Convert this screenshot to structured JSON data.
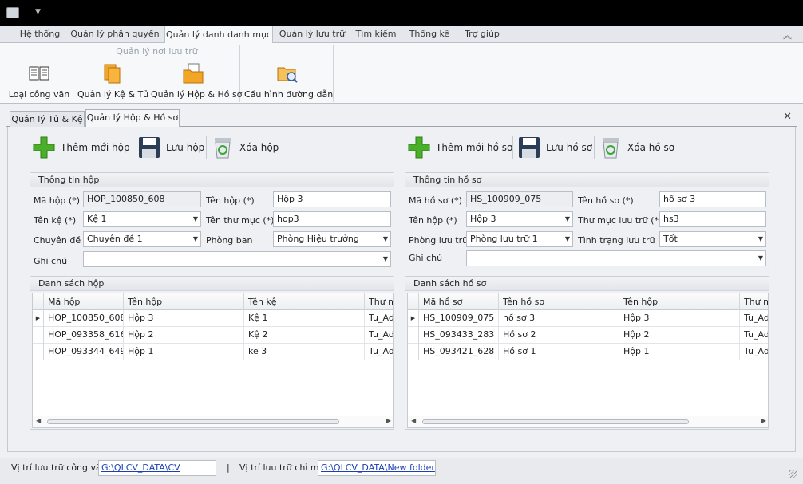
{
  "ribbon": {
    "tabs": [
      "Hệ thống",
      "Quản lý phân quyền",
      "Quản lý danh danh mục",
      "Quản lý lưu trữ",
      "Tìm kiếm",
      "Thống kê",
      "Trợ giúp"
    ],
    "group_title": "Quản lý nơi lưu trữ",
    "buttons": [
      "Loại công văn",
      "Quản lý Kệ & Tủ",
      "Quản lý Hộp & Hồ sơ",
      "Cấu hình đường dẫn"
    ]
  },
  "doc_tabs": [
    "Quản lý Tủ & Kệ",
    "Quản lý Hộp & Hồ sơ"
  ],
  "toolbar_left": {
    "add": "Thêm mới hộp",
    "save": "Lưu hộp",
    "delete": "Xóa hộp"
  },
  "toolbar_right": {
    "add": "Thêm mới hồ sơ",
    "save": "Lưu hồ sơ",
    "delete": "Xóa hồ sơ"
  },
  "box_info": {
    "title": "Thông tin hộp",
    "labels": {
      "code": "Mã hộp (*)",
      "name": "Tên hộp (*)",
      "shelf": "Tên kệ (*)",
      "folder": "Tên thư mục (*)",
      "topic": "Chuyên đề",
      "dept": "Phòng ban",
      "note": "Ghi chú"
    },
    "values": {
      "code": "HOP_100850_608",
      "name": "Hộp 3",
      "shelf": "Kệ 1",
      "folder": "hop3",
      "topic": "Chuyên đề 1",
      "dept": "Phòng Hiệu trưởng",
      "note": ""
    }
  },
  "file_info": {
    "title": "Thông tin hồ sơ",
    "labels": {
      "code": "Mã hồ sơ (*)",
      "name": "Tên hồ sơ (*)",
      "box": "Tên hộp (*)",
      "folder": "Thư mục lưu trữ (*)",
      "room": "Phòng lưu trữ",
      "status": "Tình trạng lưu trữ",
      "note": "Ghi chú"
    },
    "values": {
      "code": "HS_100909_075",
      "name": "hồ sơ 3",
      "box": "Hộp 3",
      "folder": "hs3",
      "room": "Phòng lưu trữ 1",
      "status": "Tốt",
      "note": ""
    }
  },
  "box_list": {
    "title": "Danh sách hộp",
    "columns": [
      "Mã hộp",
      "Tên hộp",
      "Tên kệ",
      "Thư mục"
    ],
    "rows": [
      [
        "HOP_100850_608",
        "Hộp 3",
        "Kệ 1",
        "Tu_Admin"
      ],
      [
        "HOP_093358_616",
        "Hộp 2",
        "Kệ 2",
        "Tu_Admin"
      ],
      [
        "HOP_093344_649",
        "Hộp 1",
        "ke 3",
        "Tu_Admin"
      ]
    ]
  },
  "file_list": {
    "title": "Danh sách hồ sơ",
    "columns": [
      "Mã hồ sơ",
      "Tên hồ sơ",
      "Tên hộp",
      "Thư mục"
    ],
    "rows": [
      [
        "HS_100909_075",
        "hồ sơ 3",
        "Hộp 3",
        "Tu_Admin"
      ],
      [
        "HS_093433_283",
        "Hồ sơ 2",
        "Hộp 2",
        "Tu_Admin"
      ],
      [
        "HS_093421_628",
        "Hồ sơ 1",
        "Hộp 1",
        "Tu_Admin"
      ]
    ]
  },
  "status": {
    "cv_label": "Vị trí lưu trữ công văn",
    "cv_path": "G:\\QLCV_DATA\\CV",
    "sep": "|",
    "dir_label": "Vị trí lưu trữ chỉ mục",
    "dir_path": "G:\\QLCV_DATA\\New folder"
  },
  "colors": {
    "add": "#4caf2a",
    "save": "#2c3e57",
    "recycle": "#3aa535",
    "accent": "#1b3fb5"
  }
}
